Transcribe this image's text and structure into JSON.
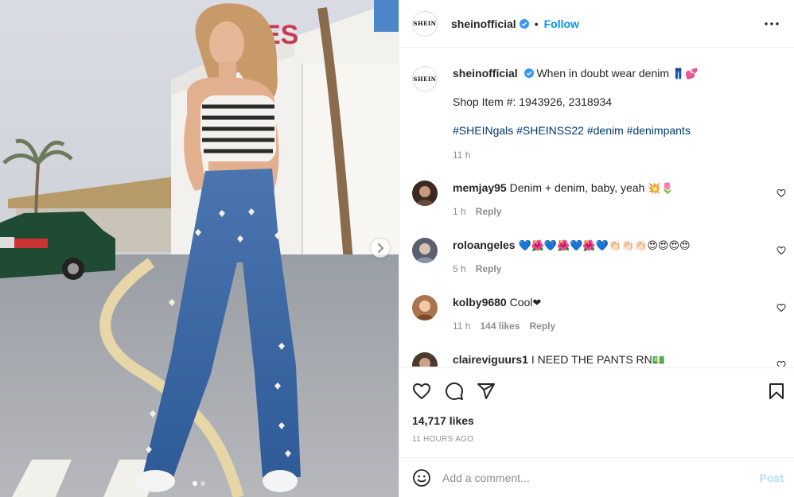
{
  "header": {
    "logo_text": "SHEIN",
    "username": "sheinofficial",
    "separator": "•",
    "follow_label": "Follow"
  },
  "caption": {
    "username": "sheinofficial",
    "text": "When in doubt wear denim",
    "emoji": "👖💕",
    "shop_line": "Shop Item #: 1943926, 2318934",
    "hashtags": "#SHEINgals #SHEINSS22 #denim #denimpants",
    "time": "11 h"
  },
  "comments": [
    {
      "username": "memjay95",
      "text": "Denim + denim, baby, yeah",
      "emoji": "💥🌷",
      "time": "1 h",
      "likes": "",
      "reply": "Reply",
      "avatar_color": "#3a2a22"
    },
    {
      "username": "roloangeles",
      "text": "",
      "emoji": "💙🌺💙🌺💙🌺💙👏🏻👏🏻👏🏻😍😍😍😍",
      "time": "5 h",
      "likes": "",
      "reply": "Reply",
      "avatar_color": "#5a6070"
    },
    {
      "username": "kolby9680",
      "text": "Cool",
      "emoji": "❤",
      "time": "11 h",
      "likes": "144 likes",
      "reply": "Reply",
      "avatar_color": "#a9744e"
    },
    {
      "username": "claireviguurs1",
      "text": "I NEED THE PANTS RN",
      "emoji": "💵",
      "time": "",
      "likes": "",
      "reply": "",
      "avatar_color": "#4b3a30"
    }
  ],
  "stats": {
    "likes": "14,717 likes",
    "posted": "11 HOURS AGO"
  },
  "add_comment": {
    "placeholder": "Add a comment...",
    "post_label": "Post"
  },
  "icons": {
    "more": "more-horizontal-icon",
    "like": "heart-outline-icon",
    "comment": "comment-bubble-icon",
    "share": "paper-plane-icon",
    "save": "bookmark-icon",
    "emoji": "smiley-icon",
    "verified": "verified-badge-icon"
  },
  "colors": {
    "accent": "#0095f6",
    "hashtag": "#00376b",
    "muted": "#8e8e8e",
    "post_disabled": "#b2dffc",
    "verified": "#3897f0"
  },
  "media": {
    "sign_text": "ES",
    "slide_count": 2,
    "active_slide": 1
  }
}
